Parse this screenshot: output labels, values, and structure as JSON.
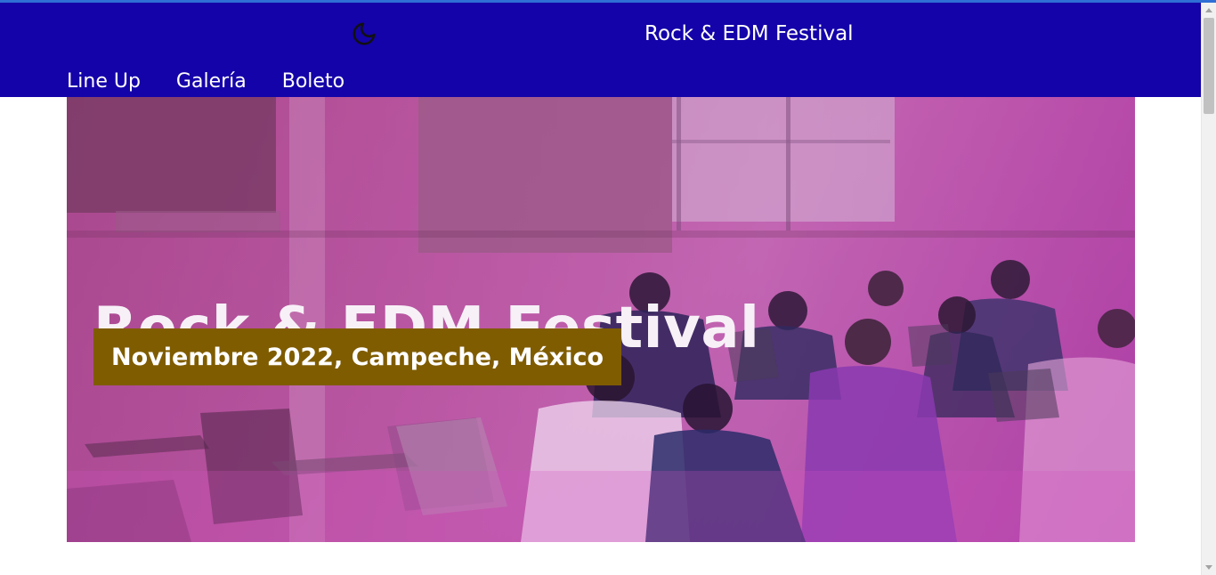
{
  "header": {
    "brand": "Rock & EDM Festival",
    "theme_icon": "moon-icon",
    "nav": [
      {
        "label": "Line Up"
      },
      {
        "label": "Galería"
      },
      {
        "label": "Boleto"
      }
    ]
  },
  "hero": {
    "title": "Rock & EDM Festival",
    "subtitle": "Noviembre 2022, Campeche, México",
    "badge_color": "#7f5c00",
    "overlay_color": "#c04fb5"
  },
  "colors": {
    "header_bg": "#1403a8",
    "text_light": "#ffffff"
  }
}
